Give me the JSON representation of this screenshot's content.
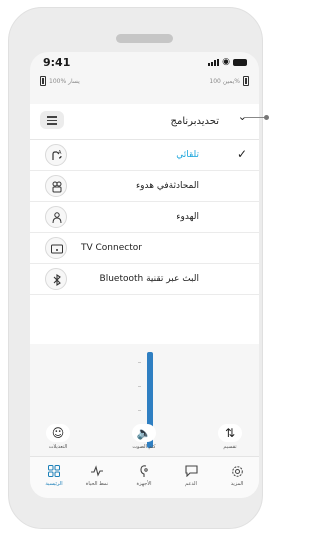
{
  "status": {
    "time": "9:41"
  },
  "hearing_aids": {
    "left": {
      "label": "يسار",
      "battery": "100%"
    },
    "right": {
      "label": "يمين",
      "battery": "100%"
    }
  },
  "program_menu": {
    "title": "تحديدبرنامج",
    "selected_index": 0,
    "items": [
      {
        "label": "تلقائي",
        "icon": "auto-program-icon",
        "active": true
      },
      {
        "label": "المحادثةفي هدوء",
        "icon": "conversation-icon",
        "active": false
      },
      {
        "label": "الهدوء",
        "icon": "quiet-icon",
        "active": false
      },
      {
        "label": "TV Connector",
        "icon": "tv-connector-icon",
        "active": false
      },
      {
        "label": "البث عبر تقنية Bluetooth",
        "icon": "bluetooth-icon",
        "active": false
      }
    ]
  },
  "volume": {
    "level": 1.0
  },
  "controls": {
    "adjustments": {
      "label": "التعديلات",
      "icon": "smiley-icon"
    },
    "mute": {
      "label": "كتم الصوت",
      "icon": "speaker-icon"
    },
    "split": {
      "label": "تقسيم",
      "icon": "split-icon"
    }
  },
  "tabs": [
    {
      "label": "الرئيسية",
      "icon": "home-grid-icon",
      "active": true
    },
    {
      "label": "نمط الحياة",
      "icon": "pulse-icon",
      "active": false
    },
    {
      "label": "الأجهزة",
      "icon": "hearing-aid-icon",
      "active": false
    },
    {
      "label": "الدعم",
      "icon": "chat-bubble-icon",
      "active": false
    },
    {
      "label": "المزيد",
      "icon": "gear-icon",
      "active": false
    }
  ]
}
